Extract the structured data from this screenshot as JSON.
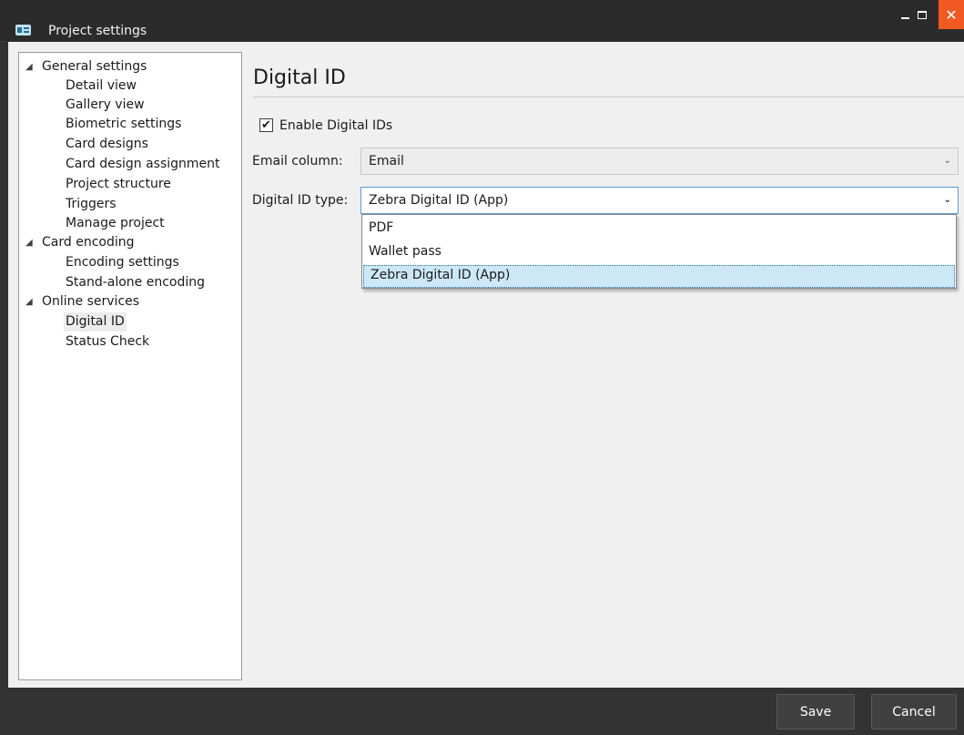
{
  "window": {
    "title": "Project settings",
    "icon": "id-card-icon",
    "controls": {
      "minimize": "minimize-icon",
      "maximize": "maximize-icon",
      "close": "close-icon"
    },
    "close_color": "#f05a22"
  },
  "tree": {
    "groups": [
      {
        "label": "General settings",
        "items": [
          "Detail view",
          "Gallery view",
          "Biometric settings",
          "Card designs",
          "Card design assignment",
          "Project structure",
          "Triggers",
          "Manage project"
        ]
      },
      {
        "label": "Card encoding",
        "items": [
          "Encoding settings",
          "Stand-alone encoding"
        ]
      },
      {
        "label": "Online services",
        "items": [
          "Digital ID",
          "Status Check"
        ]
      }
    ],
    "selected": "Digital ID"
  },
  "page": {
    "heading": "Digital ID",
    "enable_checkbox": {
      "label": "Enable Digital IDs",
      "checked": true
    },
    "email_column": {
      "label": "Email column:",
      "value": "Email"
    },
    "digital_id_type": {
      "label": "Digital ID type:",
      "value": "Zebra Digital ID (App)",
      "options": [
        "PDF",
        "Wallet pass",
        "Zebra Digital ID (App)"
      ],
      "highlight_color": "#cce8f7"
    }
  },
  "footer": {
    "save_label": "Save",
    "cancel_label": "Cancel"
  }
}
